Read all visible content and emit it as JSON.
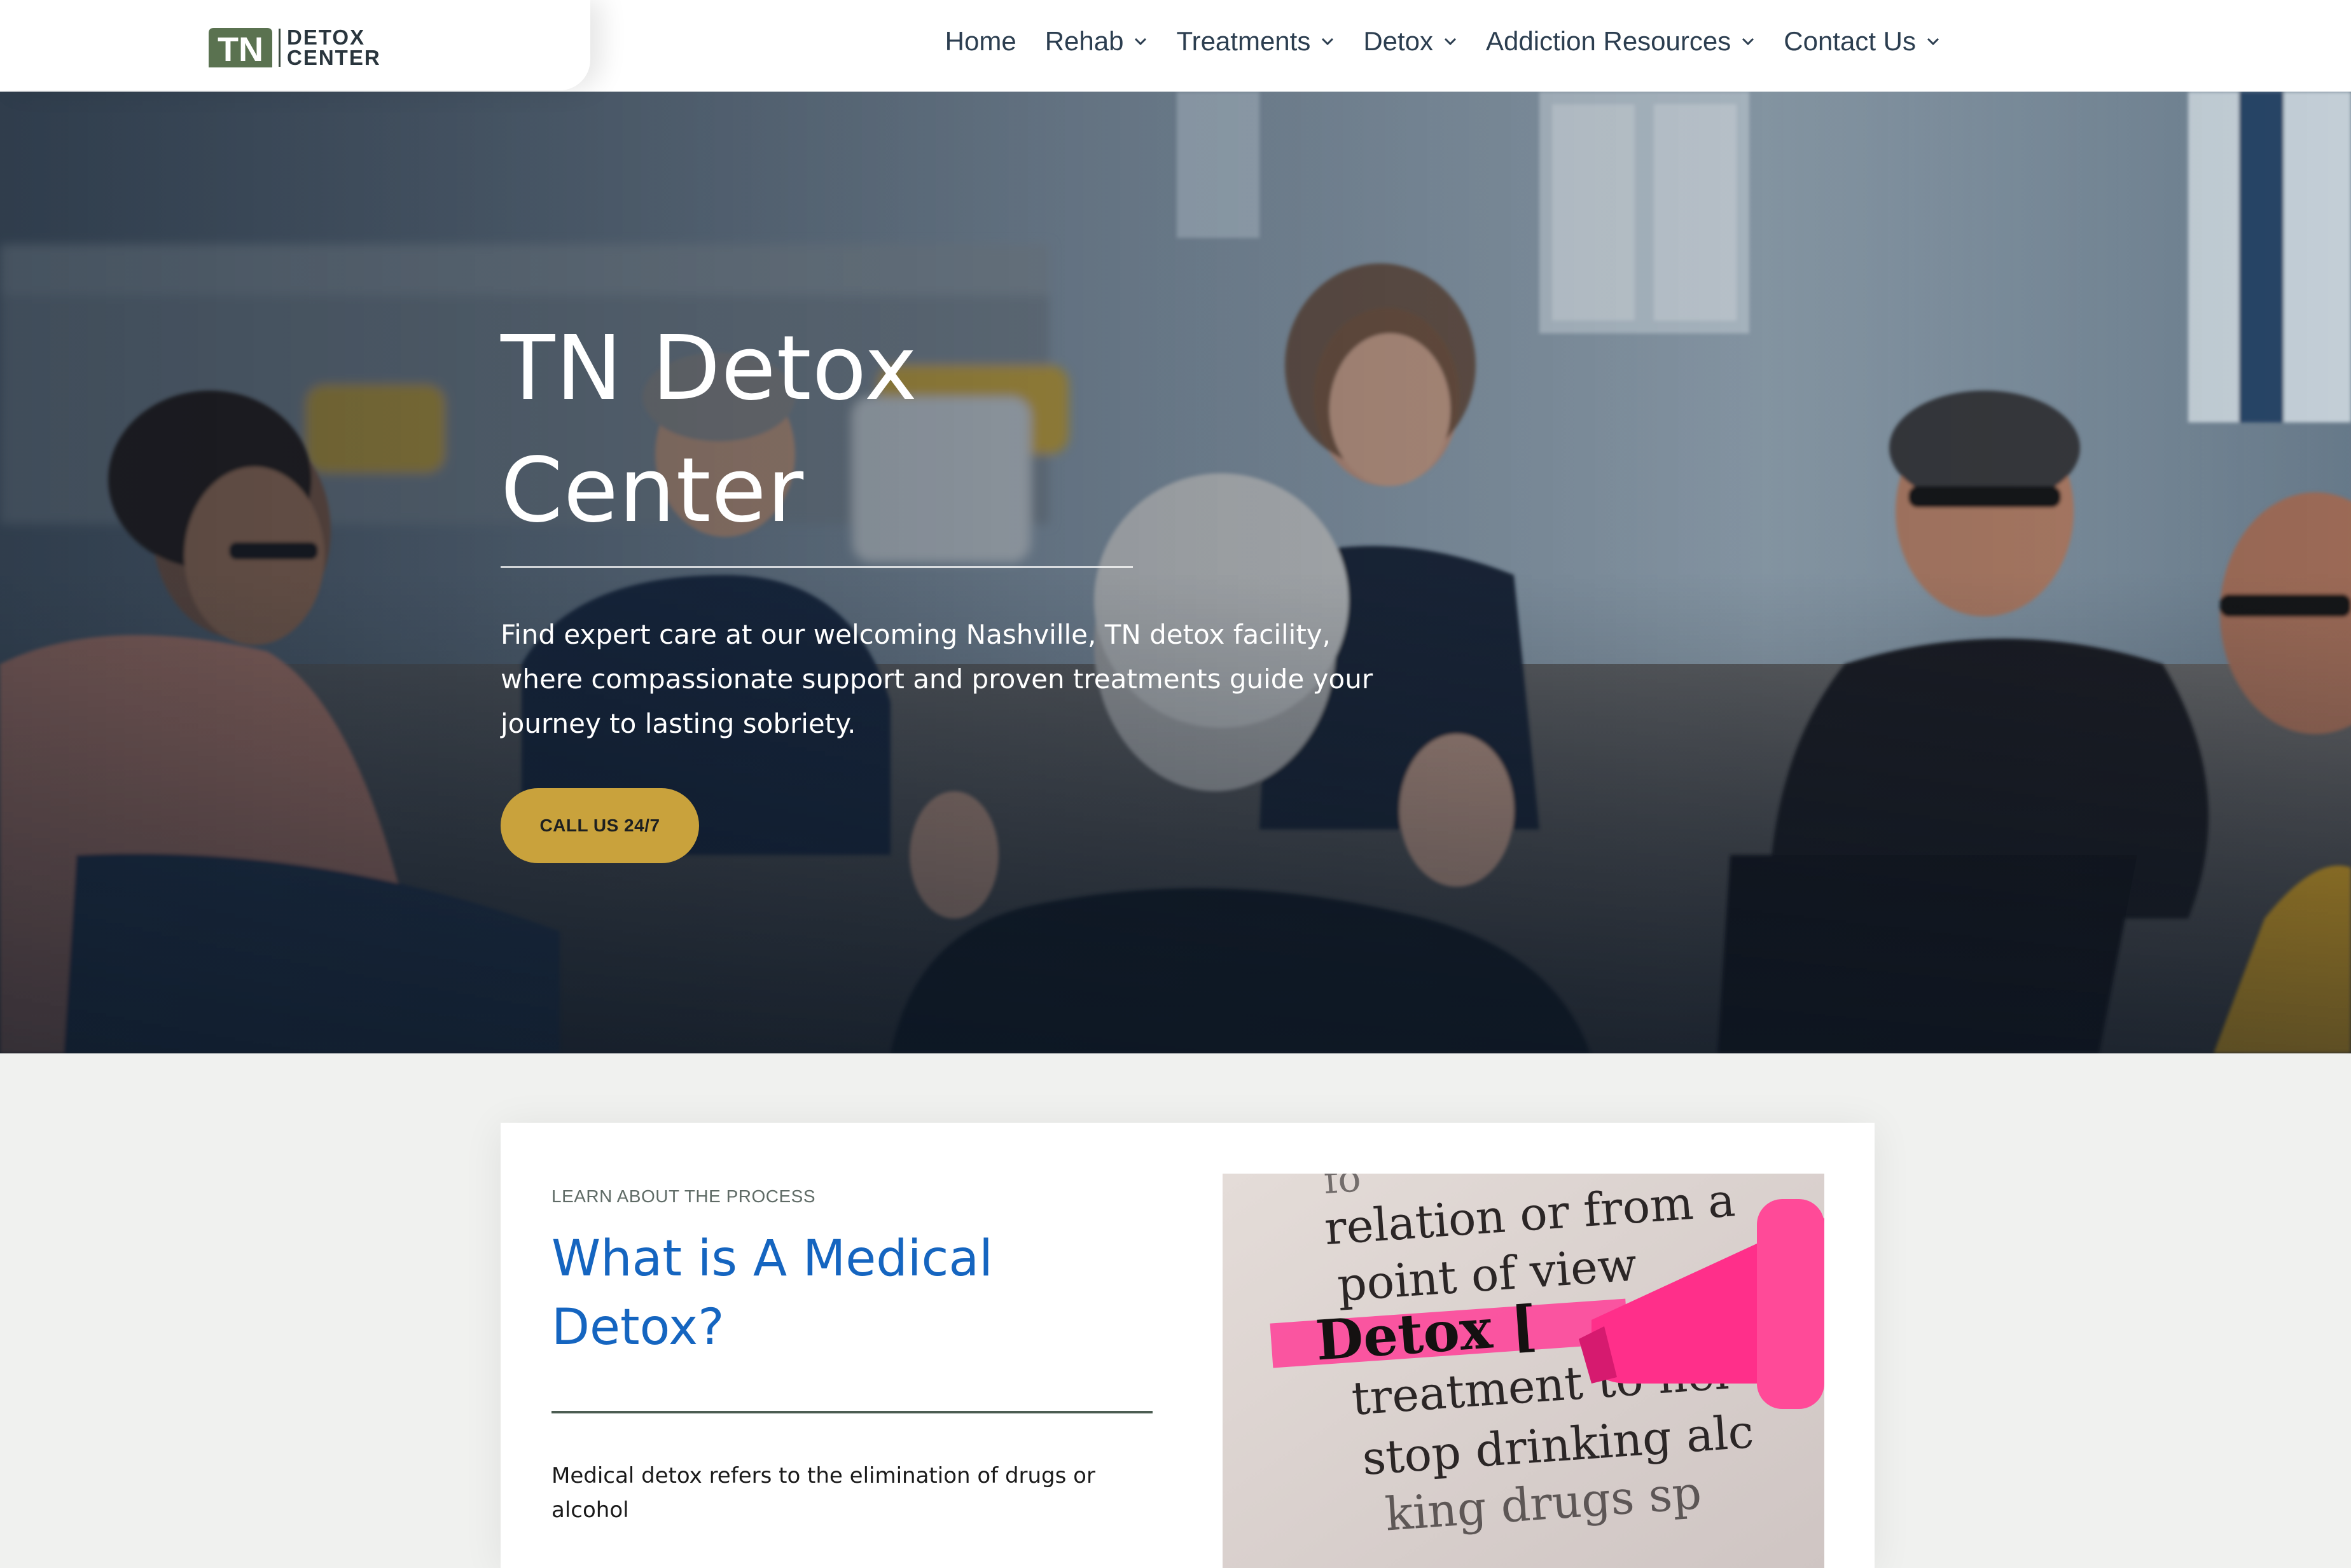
{
  "logo": {
    "mark": "TN",
    "line1": "DETOX",
    "line2": "CENTER"
  },
  "nav": {
    "items": [
      {
        "label": "Home",
        "dropdown": false
      },
      {
        "label": "Rehab",
        "dropdown": true
      },
      {
        "label": "Treatments",
        "dropdown": true
      },
      {
        "label": "Detox",
        "dropdown": true
      },
      {
        "label": "Addiction Resources",
        "dropdown": true
      },
      {
        "label": "Contact Us",
        "dropdown": true
      }
    ]
  },
  "hero": {
    "title_line1": "TN Detox",
    "title_line2": "Center",
    "description": "Find expert care at our welcoming Nashville, TN detox facility, where compassionate support and proven treatments guide your journey to lasting sobriety.",
    "cta_label": "CALL US 24/7"
  },
  "section": {
    "eyebrow": "LEARN ABOUT THE PROCESS",
    "title_line1": "What is A Medical",
    "title_line2": "Detox?",
    "body": "Medical detox refers to the elimination of drugs or alcohol",
    "image_text": {
      "line1": "relation or from a",
      "line2": "point of view",
      "line3": "Detox [",
      "line4": "treatment to hel",
      "line5": "stop drinking alc"
    }
  },
  "colors": {
    "accent_gold": "#c9a23c",
    "title_blue": "#1565c0",
    "nav_text": "#2c3e50",
    "logo_green": "#5a7250",
    "highlight_pink": "#ff2f8a"
  }
}
